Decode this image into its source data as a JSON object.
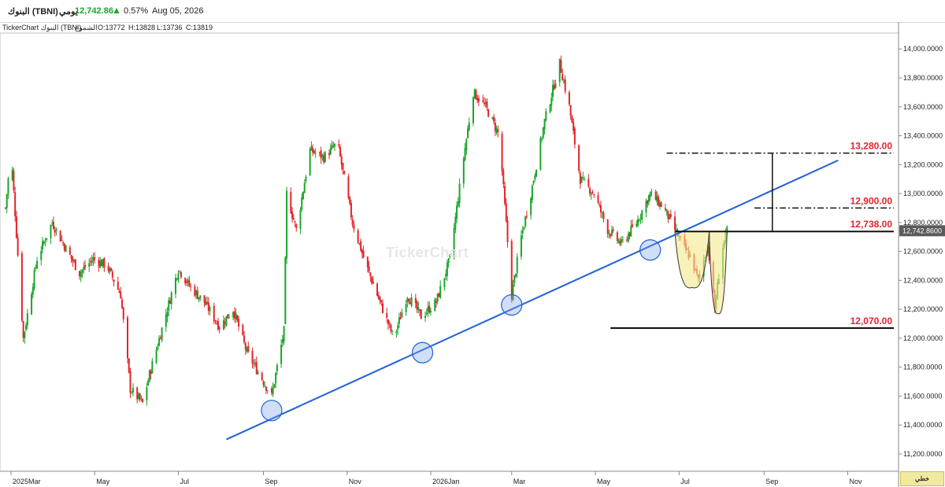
{
  "header": {
    "name": "البنوك (TBNI)",
    "period": "يومي",
    "price": "12,742.86",
    "change": "0.57%",
    "date": "Aug 05, 2026",
    "up_color": "#1aa52b"
  },
  "subheader": {
    "source": "TickerChart البنوك (TBNI)",
    "candles_label": "الشموع",
    "open": "O:13772",
    "high": "H:13828",
    "low": "L:13736",
    "close": "C:13819"
  },
  "watermark": "TickerChart",
  "corner_label": "خطي",
  "chart_data": {
    "type": "candlestick",
    "up_color": "#1aa52b",
    "down_color": "#e3242b",
    "x_tick_labels": [
      "2025Mar",
      "May",
      "Jul",
      "Sep",
      "Nov",
      "2026Jan",
      "Mar",
      "May",
      "Jul",
      "Sep",
      "Nov"
    ],
    "x_ticks": [
      "2025-03-01",
      "2025-05-01",
      "2025-07-01",
      "2025-09-01",
      "2025-11-01",
      "2026-01-01",
      "2026-03-01",
      "2026-05-01",
      "2026-07-01",
      "2026-09-01",
      "2026-11-01"
    ],
    "y_ticks": [
      "11,200.0000",
      "11,400.0000",
      "11,600.0000",
      "11,800.0000",
      "12,000.0000",
      "12,200.0000",
      "12,400.0000",
      "12,600.0000",
      "12,800.0000",
      "13,000.0000",
      "13,200.0000",
      "13,400.0000",
      "13,600.0000",
      "13,800.0000",
      "14,000.0000"
    ],
    "ylim": [
      11080,
      14110
    ],
    "last_price_label": "12,742.8600",
    "close_path": [
      [
        "2025-02-25",
        12900
      ],
      [
        "2025-03-01",
        13300
      ],
      [
        "2025-03-10",
        12000
      ],
      [
        "2025-03-20",
        12550
      ],
      [
        "2025-03-31",
        12800
      ],
      [
        "2025-04-10",
        12620
      ],
      [
        "2025-04-20",
        12450
      ],
      [
        "2025-04-30",
        12550
      ],
      [
        "2025-05-10",
        12500
      ],
      [
        "2025-05-20",
        12300
      ],
      [
        "2025-05-27",
        11650
      ],
      [
        "2025-06-05",
        11550
      ],
      [
        "2025-06-10",
        11750
      ],
      [
        "2025-06-20",
        12100
      ],
      [
        "2025-07-01",
        12480
      ],
      [
        "2025-07-10",
        12350
      ],
      [
        "2025-07-20",
        12250
      ],
      [
        "2025-07-31",
        12080
      ],
      [
        "2025-08-10",
        12200
      ],
      [
        "2025-08-20",
        11900
      ],
      [
        "2025-08-31",
        11720
      ],
      [
        "2025-09-07",
        11600
      ],
      [
        "2025-09-12",
        11850
      ],
      [
        "2025-09-16",
        12050
      ],
      [
        "2025-09-18",
        13000
      ],
      [
        "2025-09-25",
        12750
      ],
      [
        "2025-10-05",
        13300
      ],
      [
        "2025-10-15",
        13250
      ],
      [
        "2025-10-25",
        13350
      ],
      [
        "2025-11-05",
        12800
      ],
      [
        "2025-11-15",
        12500
      ],
      [
        "2025-11-25",
        12250
      ],
      [
        "2025-12-05",
        12000
      ],
      [
        "2025-12-15",
        12300
      ],
      [
        "2025-12-25",
        12150
      ],
      [
        "2026-01-05",
        12250
      ],
      [
        "2026-01-15",
        12550
      ],
      [
        "2026-01-25",
        13250
      ],
      [
        "2026-02-01",
        13700
      ],
      [
        "2026-02-10",
        13600
      ],
      [
        "2026-02-20",
        13400
      ],
      [
        "2026-03-01",
        12300
      ],
      [
        "2026-03-08",
        12700
      ],
      [
        "2026-03-15",
        13000
      ],
      [
        "2026-03-25",
        13500
      ],
      [
        "2026-04-05",
        13900
      ],
      [
        "2026-04-12",
        13600
      ],
      [
        "2026-04-20",
        13100
      ],
      [
        "2026-04-30",
        13000
      ],
      [
        "2026-05-10",
        12750
      ],
      [
        "2026-05-20",
        12650
      ],
      [
        "2026-05-31",
        12800
      ],
      [
        "2026-06-10",
        13000
      ],
      [
        "2026-06-20",
        12900
      ],
      [
        "2026-06-28",
        12750
      ],
      [
        "2026-07-05",
        12620
      ],
      [
        "2026-07-10",
        12550
      ],
      [
        "2026-07-15",
        12400
      ],
      [
        "2026-07-22",
        12650
      ],
      [
        "2026-07-27",
        12200
      ],
      [
        "2026-08-01",
        12600
      ],
      [
        "2026-08-05",
        12742.86
      ]
    ],
    "trendline": {
      "from": [
        "2025-08-05",
        11300
      ],
      "to": [
        "2026-10-25",
        13230
      ],
      "touch_points": [
        [
          "2025-09-07",
          11500
        ],
        [
          "2025-12-26",
          11900
        ],
        [
          "2026-03-01",
          12230
        ],
        [
          "2026-06-10",
          12610
        ]
      ]
    },
    "levels": [
      {
        "label": "13,280.00",
        "value": 13280,
        "from": "2026-06-22",
        "style": "dash-dot"
      },
      {
        "label": "12,900.00",
        "value": 12900,
        "from": "2026-08-25",
        "style": "dash-dot"
      },
      {
        "label": "12,738.00",
        "value": 12738,
        "from": "2026-06-28",
        "style": "solid"
      },
      {
        "label": "12,070.00",
        "value": 12070,
        "from": "2026-05-12",
        "style": "solid"
      }
    ],
    "target_marker": {
      "date": "2026-09-07",
      "from": 12738,
      "to": 13280
    },
    "patterns": [
      {
        "start": "2026-06-28",
        "end": "2026-07-23",
        "top": 12738,
        "bottom": 12350
      },
      {
        "start": "2026-07-23",
        "end": "2026-08-05",
        "top": 12738,
        "bottom": 12170
      }
    ]
  }
}
